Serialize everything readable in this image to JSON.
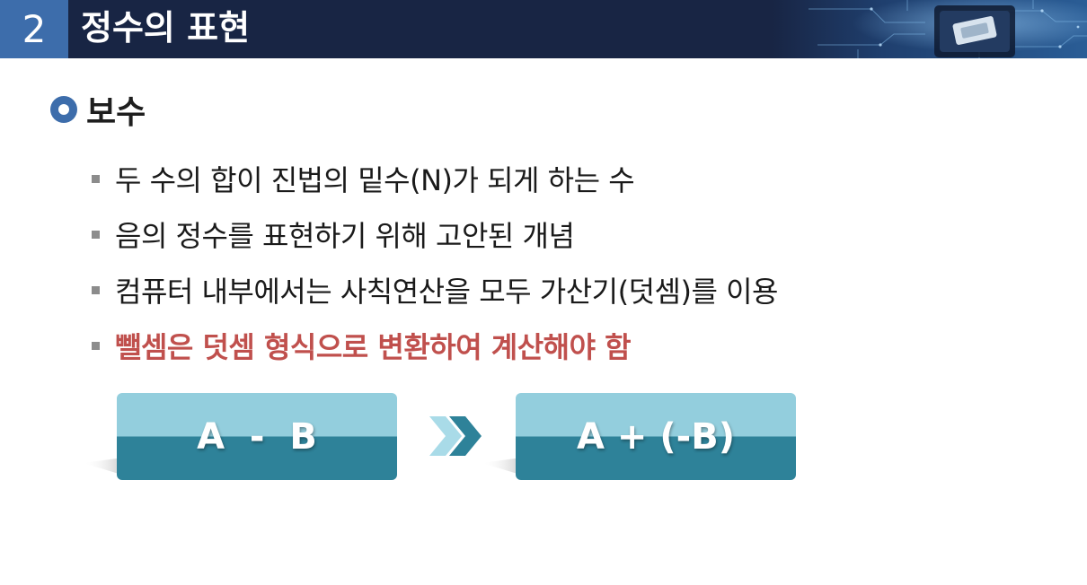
{
  "header": {
    "number": "2",
    "title": "정수의 표현",
    "art_icon": "circuit-chip-icon",
    "bar_color": "#182544",
    "number_bg_color": "#3d6dab"
  },
  "section": {
    "icon": "ring-bullet-icon",
    "title": "보수"
  },
  "bullets": [
    {
      "text": "두 수의 합이 진법의 밑수(N)가 되게 하는 수",
      "emphasis": false
    },
    {
      "text": "음의 정수를 표현하기 위해 고안된 개념",
      "emphasis": false
    },
    {
      "text": "컴퓨터 내부에서는 사칙연산을 모두 가산기(덧셈)를 이용",
      "emphasis": false
    },
    {
      "text": "뺄셈은 덧셈 형식으로 변환하여 계산해야 함",
      "emphasis": true
    }
  ],
  "formula": {
    "left": "A  -  B",
    "right": "A + (-B)",
    "arrow_icon": "double-chevron-right-icon",
    "top_color": "#93cedd",
    "bottom_color": "#2e8299",
    "emphasis_color": "#c0504d"
  }
}
